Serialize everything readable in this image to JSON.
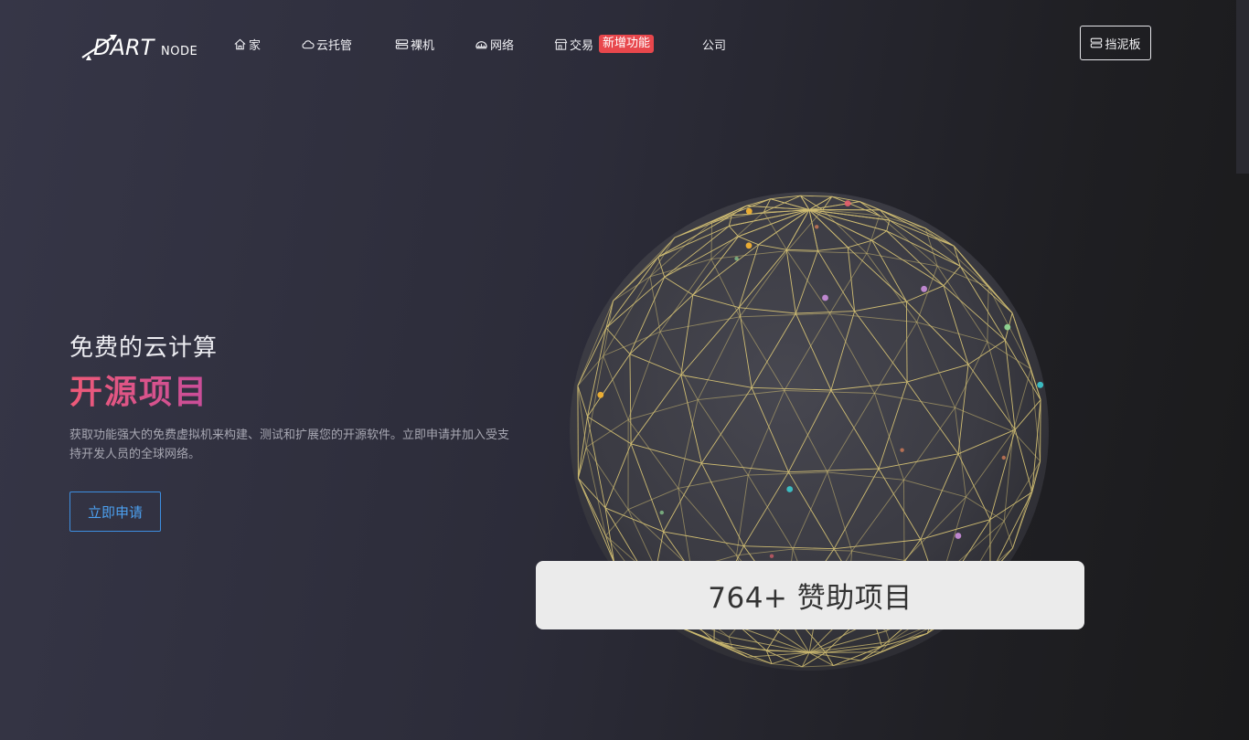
{
  "nav": {
    "brand": "DARTNode",
    "items": [
      {
        "label": "家",
        "icon": "home-icon"
      },
      {
        "label": "云托管",
        "icon": "cloud-icon"
      },
      {
        "label": "裸机",
        "icon": "server-icon"
      },
      {
        "label": "网络",
        "icon": "network-icon"
      },
      {
        "label": "交易",
        "icon": "store-icon",
        "badge": "新增功能"
      },
      {
        "label": "公司"
      }
    ],
    "dashboard_label": "挡泥板"
  },
  "hero": {
    "subtitle": "免费的云计算",
    "title": "开源项目",
    "description": "获取功能强大的免费虚拟机来构建、测试和扩展您的开源软件。立即申请并加入受支持开发人员的全球网络。",
    "cta_label": "立即申请"
  },
  "counter": {
    "text": "764+ 赞助项目"
  },
  "colors": {
    "accent_pink": "#e04f86",
    "cta_blue": "#4ca0f0",
    "badge_red": "#e8474c",
    "wire_gold": "#e8d27a"
  }
}
